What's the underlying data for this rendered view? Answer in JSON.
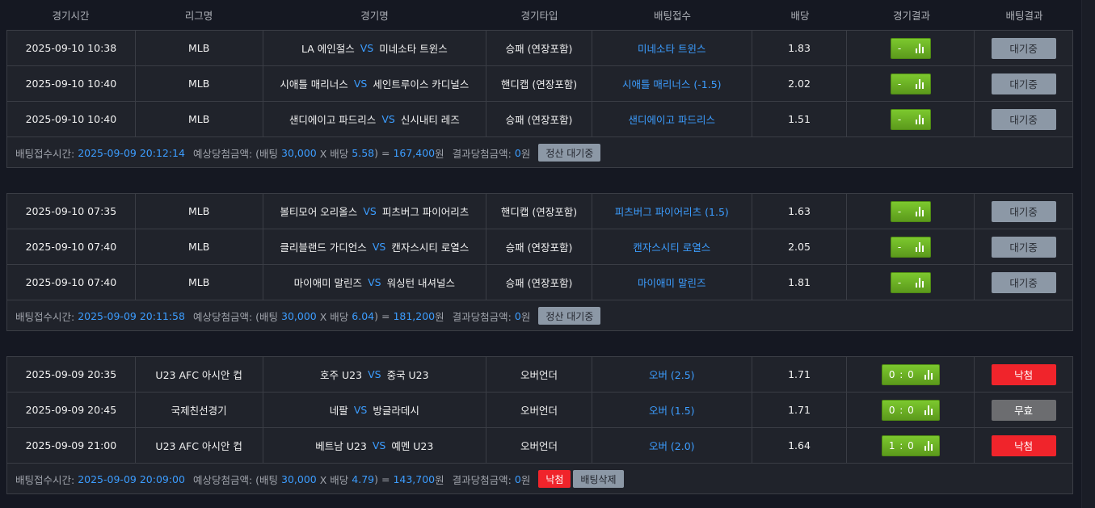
{
  "header": {
    "time": "경기시간",
    "league": "리그명",
    "match": "경기명",
    "type": "경기타입",
    "bet": "배팅접수",
    "odds": "배당",
    "result": "경기결과",
    "bet_result": "배팅결과"
  },
  "groups": [
    {
      "rows": [
        {
          "time": "2025-09-10 10:38",
          "league": "MLB",
          "home": "LA 에인절스",
          "vs": "VS",
          "away": "미네소타 트윈스",
          "type": "승패 (연장포함)",
          "pick": "미네소타 트윈스",
          "odds": "1.83",
          "score": "-",
          "status": "대기중"
        },
        {
          "time": "2025-09-10 10:40",
          "league": "MLB",
          "home": "시애틀 매리너스",
          "vs": "VS",
          "away": "세인트루이스 카디널스",
          "type": "핸디캡 (연장포함)",
          "pick": "시애틀 매리너스 (-1.5)",
          "odds": "2.02",
          "score": "-",
          "status": "대기중"
        },
        {
          "time": "2025-09-10 10:40",
          "league": "MLB",
          "home": "샌디에이고 파드리스",
          "vs": "VS",
          "away": "신시내티 레즈",
          "type": "승패 (연장포함)",
          "pick": "샌디에이고 파드리스",
          "odds": "1.51",
          "score": "-",
          "status": "대기중"
        }
      ],
      "summary": {
        "time_label": "배팅접수시간:",
        "time": "2025-09-09 20:12:14",
        "expected_label": "예상당첨금액: (배팅",
        "stake": "30,000",
        "x_label": "X 배당",
        "total_odds": "5.58",
        "eq": ")  =",
        "expected": "167,400",
        "won": "원",
        "result_label": "결과당첨금액:",
        "result_amount": "0",
        "result_won": "원",
        "badge": "정산 대기중"
      }
    },
    {
      "rows": [
        {
          "time": "2025-09-10 07:35",
          "league": "MLB",
          "home": "볼티모어 오리올스",
          "vs": "VS",
          "away": "피츠버그 파이어리츠",
          "type": "핸디캡 (연장포함)",
          "pick": "피츠버그 파이어리츠 (1.5)",
          "odds": "1.63",
          "score": "-",
          "status": "대기중"
        },
        {
          "time": "2025-09-10 07:40",
          "league": "MLB",
          "home": "클리블랜드 가디언스",
          "vs": "VS",
          "away": "캔자스시티 로열스",
          "type": "승패 (연장포함)",
          "pick": "캔자스시티 로열스",
          "odds": "2.05",
          "score": "-",
          "status": "대기중"
        },
        {
          "time": "2025-09-10 07:40",
          "league": "MLB",
          "home": "마이애미 말린즈",
          "vs": "VS",
          "away": "워싱턴 내셔널스",
          "type": "승패 (연장포함)",
          "pick": "마이애미 말린즈",
          "odds": "1.81",
          "score": "-",
          "status": "대기중"
        }
      ],
      "summary": {
        "time_label": "배팅접수시간:",
        "time": "2025-09-09 20:11:58",
        "expected_label": "예상당첨금액: (배팅",
        "stake": "30,000",
        "x_label": "X 배당",
        "total_odds": "6.04",
        "eq": ")  =",
        "expected": "181,200",
        "won": "원",
        "result_label": "결과당첨금액:",
        "result_amount": "0",
        "result_won": "원",
        "badge": "정산 대기중"
      }
    },
    {
      "rows": [
        {
          "time": "2025-09-09 20:35",
          "league": "U23 AFC 아시안 컵",
          "home": "호주 U23",
          "vs": "VS",
          "away": "중국 U23",
          "type": "오버언더",
          "pick": "오버 (2.5)",
          "odds": "1.71",
          "score": "0 : 0",
          "status": "낙첨"
        },
        {
          "time": "2025-09-09 20:45",
          "league": "국제친선경기",
          "home": "네팔",
          "vs": "VS",
          "away": "방글라데시",
          "type": "오버언더",
          "pick": "오버 (1.5)",
          "odds": "1.71",
          "score": "0 : 0",
          "status": "무효"
        },
        {
          "time": "2025-09-09 21:00",
          "league": "U23 AFC 아시안 컵",
          "home": "베트남 U23",
          "vs": "VS",
          "away": "예멘 U23",
          "type": "오버언더",
          "pick": "오버 (2.0)",
          "odds": "1.64",
          "score": "1 : 0",
          "status": "낙첨"
        }
      ],
      "summary": {
        "time_label": "배팅접수시간:",
        "time": "2025-09-09 20:09:00",
        "expected_label": "예상당첨금액: (배팅",
        "stake": "30,000",
        "x_label": "X 배당",
        "total_odds": "4.79",
        "eq": ")  =",
        "expected": "143,700",
        "won": "원",
        "result_label": "결과당첨금액:",
        "result_amount": "0",
        "result_won": "원",
        "badge": "낙첨",
        "delete_label": "배팅삭제"
      }
    }
  ],
  "colors": {
    "accent": "#3c9dff",
    "green": "#6cb325",
    "red": "#f0242b",
    "gray_badge": "#8c98a6",
    "void": "#6c6d70"
  },
  "icons": {
    "result": "bar-chart-icon"
  }
}
